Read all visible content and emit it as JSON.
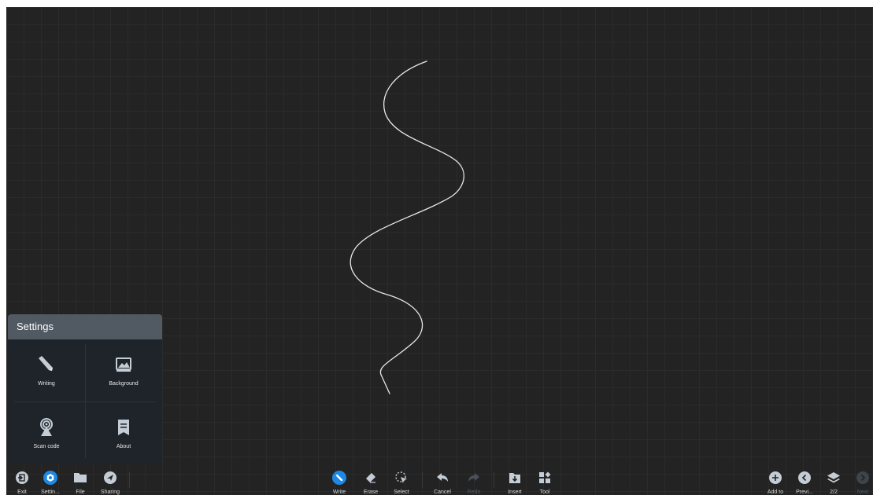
{
  "settings": {
    "title": "Settings",
    "items": [
      {
        "label": "Writing",
        "icon": "pen-icon"
      },
      {
        "label": "Background",
        "icon": "image-icon"
      },
      {
        "label": "Scan code",
        "icon": "broadcast-icon"
      },
      {
        "label": "About",
        "icon": "bookmark-doc-icon"
      }
    ]
  },
  "toolbar": {
    "left": [
      {
        "label": "Exit",
        "icon": "exit-icon"
      },
      {
        "label": "Settin...",
        "icon": "settings-icon"
      },
      {
        "label": "File",
        "icon": "folder-icon"
      },
      {
        "label": "Sharing",
        "icon": "send-icon"
      }
    ],
    "center": [
      {
        "label": "Write",
        "icon": "pen-icon"
      },
      {
        "label": "Erase",
        "icon": "eraser-icon"
      },
      {
        "label": "Select",
        "icon": "select-icon"
      },
      {
        "label": "Cancel",
        "icon": "undo-icon"
      },
      {
        "label": "Redo",
        "icon": "redo-icon"
      },
      {
        "label": "Insert",
        "icon": "insert-icon"
      },
      {
        "label": "Tool",
        "icon": "grid-icon"
      }
    ],
    "right": [
      {
        "label": "Add to",
        "icon": "add-icon"
      },
      {
        "label": "Previ...",
        "icon": "previous-icon"
      },
      {
        "label": "2/2",
        "icon": "layers-icon"
      },
      {
        "label": "Next",
        "icon": "next-icon"
      }
    ]
  },
  "colors": {
    "canvas": "#232323",
    "active": "#1e88e5",
    "icon": "#c4cdd6",
    "ink": "#e8e8e8"
  }
}
